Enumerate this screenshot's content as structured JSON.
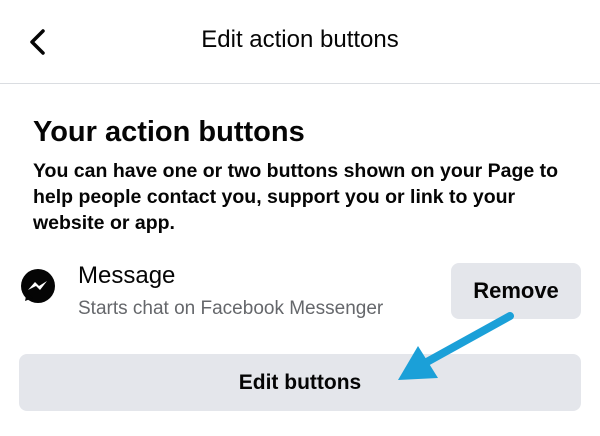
{
  "header": {
    "title": "Edit action buttons",
    "back_icon": "chevron-left-icon"
  },
  "section": {
    "title": "Your action buttons",
    "description": "You can have one or two buttons shown on your Page to help people contact you, support you or link to your website or app."
  },
  "action": {
    "icon": "messenger-icon",
    "name": "Message",
    "subtitle": "Starts chat on Facebook Messenger",
    "remove_label": "Remove"
  },
  "edit_button_label": "Edit buttons",
  "annotation": {
    "icon": "arrow-pointer-icon",
    "color": "#1ba0d8"
  },
  "colors": {
    "button_bg": "#e4e6eb",
    "secondary_text": "#65676b",
    "page_bg": "#ffffff"
  }
}
